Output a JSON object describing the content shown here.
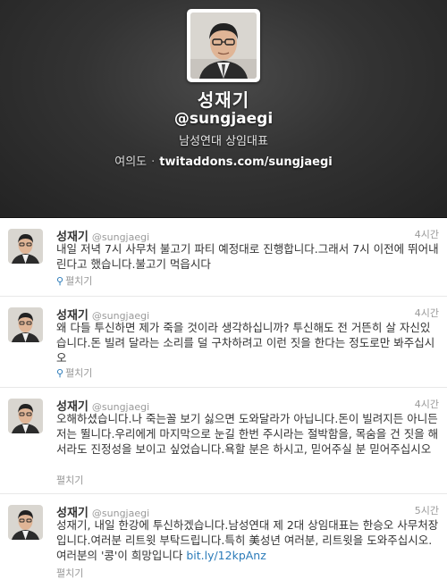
{
  "profile": {
    "name": "성재기",
    "handle": "@sungjaegi",
    "bio": "남성연대 상임대표",
    "location": "여의도",
    "separator": "·",
    "website": "twitaddons.com/sungjaegi"
  },
  "tweets": [
    {
      "name": "성재기",
      "handle": "@sungjaegi",
      "time": "4시간",
      "text": "내일 저녁 7시 사무처 불고기 파티 예정대로 진행합니다.그래서 7시 이전에 뛰어내린다고 했습니다.불고기 먹읍시다",
      "expand": "펼치기",
      "expand_icon": "location-pin-icon"
    },
    {
      "name": "성재기",
      "handle": "@sungjaegi",
      "time": "4시간",
      "text": "왜 다들 투신하면 제가 죽을 것이라 생각하십니까? 투신해도 전 거뜬히 살 자신있습니다.돈 빌려 달라는 소리를 덜 구차하려고 이런 짓을 한다는 정도로만 봐주십시오",
      "expand": "펼치기",
      "expand_icon": "location-pin-icon"
    },
    {
      "name": "성재기",
      "handle": "@sungjaegi",
      "time": "4시간",
      "text": "오해하셨습니다.나 죽는꼴 보기 싫으면 도와달라가 아닙니다.돈이 빌려지든 아니든 저는 뛸니다.우리에게 마지막으로 눈길 한번 주시라는 절박함을, 목숨을 건 짓을 해서라도 진정성을 보이고 싶었습니다.욕할 분은 하시고, 믿어주실 분 믿어주십시오",
      "expand": "펼치기"
    },
    {
      "name": "성재기",
      "handle": "@sungjaegi",
      "time": "5시간",
      "text": "성재기, 내일 한강에 투신하겠습니다.남성연대 제 2대 상임대표는 한승오 사무처장입니다.여러분 리트윗 부탁드립니다.특히 美성년 여러분, 리트윗을 도와주십시오.여러분의 '콩'이 희망입니다",
      "link": "bit.ly/12kpAnz",
      "expand": "펼치기"
    }
  ],
  "colors": {
    "header_bg": "#333333",
    "link": "#2b7bb9",
    "muted": "#999999"
  }
}
